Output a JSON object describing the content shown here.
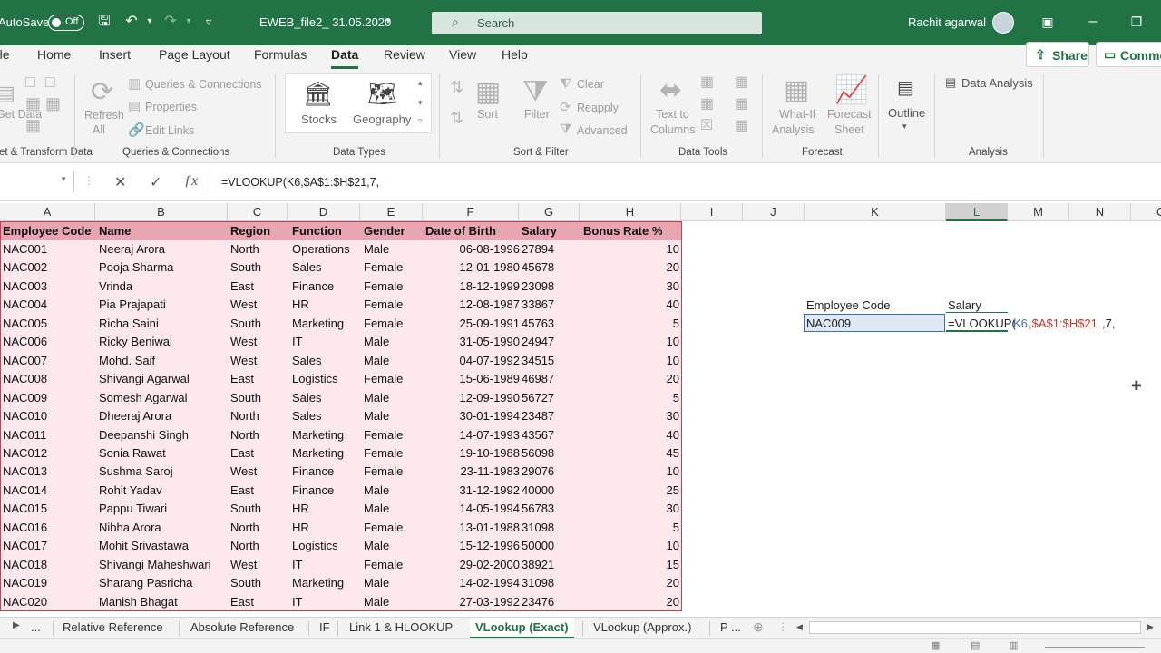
{
  "titlebar": {
    "autosave_label": "AutoSave",
    "autosave_state": "Off",
    "file_name": "EWEB_file2_ 31.05.2020",
    "search_placeholder": "Search",
    "user_name": "Rachit agarwal"
  },
  "menu_tabs": [
    "File",
    "Home",
    "Insert",
    "Page Layout",
    "Formulas",
    "Data",
    "Review",
    "View",
    "Help"
  ],
  "active_tab": "Data",
  "share_label": "Share",
  "comments_label": "Comments",
  "ribbon": {
    "get_transform": {
      "group": "Get & Transform Data",
      "items": [
        "Get Data"
      ]
    },
    "queries": {
      "refresh": "Refresh",
      "refresh_sub": "All",
      "items": [
        "Queries & Connections",
        "Properties",
        "Edit Links"
      ],
      "group": "Queries & Connections"
    },
    "data_types": {
      "items": [
        "Stocks",
        "Geography"
      ],
      "group": "Data Types"
    },
    "sort_filter": {
      "sort": "Sort",
      "filter": "Filter",
      "items": [
        "Clear",
        "Reapply",
        "Advanced"
      ],
      "group": "Sort & Filter"
    },
    "data_tools": {
      "text_to_columns_1": "Text to",
      "text_to_columns_2": "Columns",
      "group": "Data Tools"
    },
    "forecast": {
      "whatif_1": "What-If",
      "whatif_2": "Analysis",
      "sheet_1": "Forecast",
      "sheet_2": "Sheet",
      "group": "Forecast"
    },
    "outline": {
      "label": "Outline"
    },
    "analysis": {
      "item": "Data Analysis",
      "group": "Analysis"
    }
  },
  "formula_bar": {
    "name_box": "",
    "formula": "=VLOOKUP(K6,$A$1:$H$21,7,"
  },
  "column_headers": [
    "A",
    "B",
    "C",
    "D",
    "E",
    "F",
    "G",
    "H",
    "I",
    "J",
    "K",
    "L",
    "M",
    "N",
    "O"
  ],
  "table": {
    "headers": [
      "Employee Code",
      "Name",
      "Region",
      "Function",
      "Gender",
      "Date of Birth",
      "Salary",
      "Bonus Rate %"
    ],
    "rows": [
      [
        "NAC001",
        "Neeraj Arora",
        "North",
        "Operations",
        "Male",
        "06-08-1996",
        "27894",
        "10"
      ],
      [
        "NAC002",
        "Pooja Sharma",
        "South",
        "Sales",
        "Female",
        "12-01-1980",
        "45678",
        "20"
      ],
      [
        "NAC003",
        "Vrinda",
        "East",
        "Finance",
        "Female",
        "18-12-1999",
        "23098",
        "30"
      ],
      [
        "NAC004",
        "Pia Prajapati",
        "West",
        "HR",
        "Female",
        "12-08-1987",
        "33867",
        "40"
      ],
      [
        "NAC005",
        "Richa Saini",
        "South",
        "Marketing",
        "Female",
        "25-09-1991",
        "45763",
        "5"
      ],
      [
        "NAC006",
        "Ricky Beniwal",
        "West",
        "IT",
        "Male",
        "31-05-1990",
        "24947",
        "10"
      ],
      [
        "NAC007",
        "Mohd. Saif",
        "West",
        "Sales",
        "Male",
        "04-07-1992",
        "34515",
        "10"
      ],
      [
        "NAC008",
        "Shivangi Agarwal",
        "East",
        "Logistics",
        "Female",
        "15-06-1989",
        "46987",
        "20"
      ],
      [
        "NAC009",
        "Somesh Agarwal",
        "South",
        "Sales",
        "Male",
        "12-09-1990",
        "56727",
        "5"
      ],
      [
        "NAC010",
        "Dheeraj Arora",
        "North",
        "Sales",
        "Male",
        "30-01-1994",
        "23487",
        "30"
      ],
      [
        "NAC011",
        "Deepanshi Singh",
        "North",
        "Marketing",
        "Female",
        "14-07-1993",
        "43567",
        "40"
      ],
      [
        "NAC012",
        "Sonia Rawat",
        "East",
        "Marketing",
        "Female",
        "19-10-1988",
        "56098",
        "45"
      ],
      [
        "NAC013",
        "Sushma Saroj",
        "West",
        "Finance",
        "Female",
        "23-11-1983",
        "29076",
        "10"
      ],
      [
        "NAC014",
        "Rohit Yadav",
        "East",
        "Finance",
        "Male",
        "31-12-1992",
        "40000",
        "25"
      ],
      [
        "NAC015",
        "Pappu Tiwari",
        "South",
        "HR",
        "Male",
        "14-05-1994",
        "56783",
        "30"
      ],
      [
        "NAC016",
        "Nibha Arora",
        "North",
        "HR",
        "Female",
        "13-01-1988",
        "31098",
        "5"
      ],
      [
        "NAC017",
        "Mohit Srivastawa",
        "North",
        "Logistics",
        "Male",
        "15-12-1996",
        "50000",
        "10"
      ],
      [
        "NAC018",
        "Shivangi Maheshwari",
        "West",
        "IT",
        "Female",
        "29-02-2000",
        "38921",
        "15"
      ],
      [
        "NAC019",
        "Sharang Pasricha",
        "South",
        "Marketing",
        "Male",
        "14-02-1994",
        "31098",
        "20"
      ],
      [
        "NAC020",
        "Manish Bhagat",
        "East",
        "IT",
        "Male",
        "27-03-1992",
        "23476",
        "20"
      ]
    ]
  },
  "lookup": {
    "label_code": "Employee Code",
    "label_salary": "Salary",
    "code_value": "NAC009",
    "edit_formula_fn": "=VLOOKUP(",
    "edit_formula_ref": "K6",
    "edit_formula_range": ",$A$1:$H$21",
    "edit_formula_rest": ",7,"
  },
  "sheet_tabs": [
    "...",
    "Relative Reference",
    "Absolute Reference",
    "IF",
    "Link 1 & HLOOKUP",
    "VLookup (Exact)",
    "VLookup (Approx.)",
    "P ..."
  ],
  "active_sheet": "VLookup (Exact)",
  "colors": {
    "excel_green": "#217346",
    "header_pink": "#e7a6b1",
    "table_pink": "#fde9ec",
    "ref_blue": "#3b6fbf",
    "range_red": "#c0392b"
  }
}
